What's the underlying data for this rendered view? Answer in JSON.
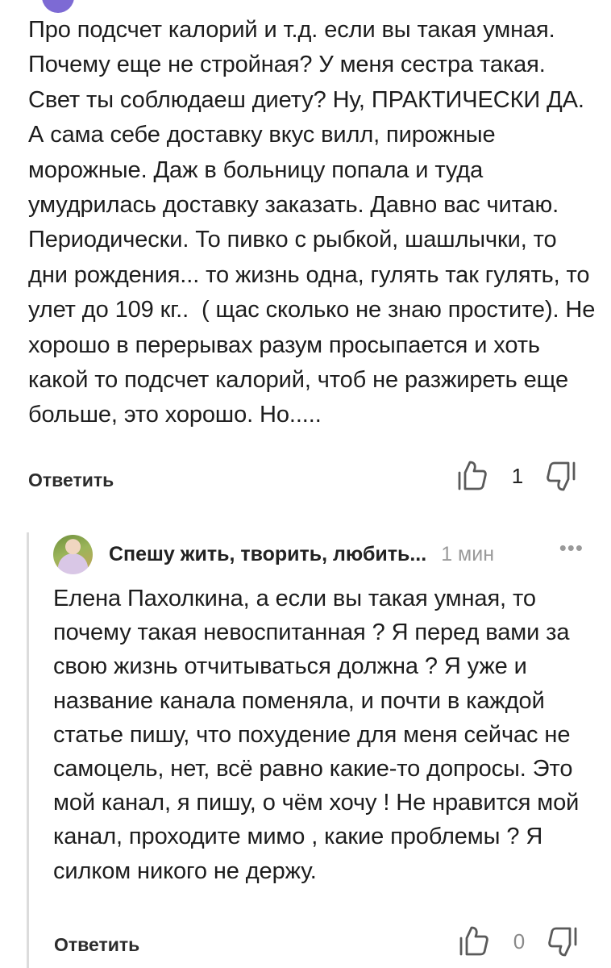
{
  "comment": {
    "text": "Про подсчет калорий и т.д. если вы такая умная. Почему еще не стройная? У меня сестра такая. Свет ты соблюдаеш диету? Ну, ПРАКТИЧЕСКИ ДА. А сама себе доставку вкус вилл, пирожные морожные. Даж в больницу попала и туда умудрилась доставку заказать. Давно вас читаю. Периодически. То пивко с рыбкой, шашлычки, то дни рождения... то жизнь одна, гулять так гулять, то улет до 109 кг..  ( щас сколько не знаю простите). Не хорошо в перерывах разум просыпается и хоть какой то подсчет калорий, чтоб не разжиреть еще больше, это хорошо. Но.....",
    "reply_label": "Ответить",
    "likes": "1"
  },
  "reply": {
    "author": "Спешу жить, творить, любить...",
    "time": "1 мин",
    "more": "•••",
    "text": "Елена Пахолкина, а если вы такая умная, то почему такая невоспитанная ? Я перед вами за свою жизнь отчитываться должна ? Я уже и название канала поменяла, и почти в каждой статье пишу, что похудение для меня сейчас не самоцель, нет, всё равно какие-то допросы. Это мой канал, я пишу, о чём хочу ! Не нравится мой канал, проходите мимо , какие проблемы ? Я силком никого не держу.",
    "reply_label": "Ответить",
    "likes": "0"
  },
  "icons": {
    "like": "thumbs-up-icon",
    "dislike": "thumbs-down-icon",
    "more": "more-dots-icon"
  },
  "colors": {
    "accent_avatar": "#7d6ad4",
    "muted": "#9a9a9a"
  }
}
